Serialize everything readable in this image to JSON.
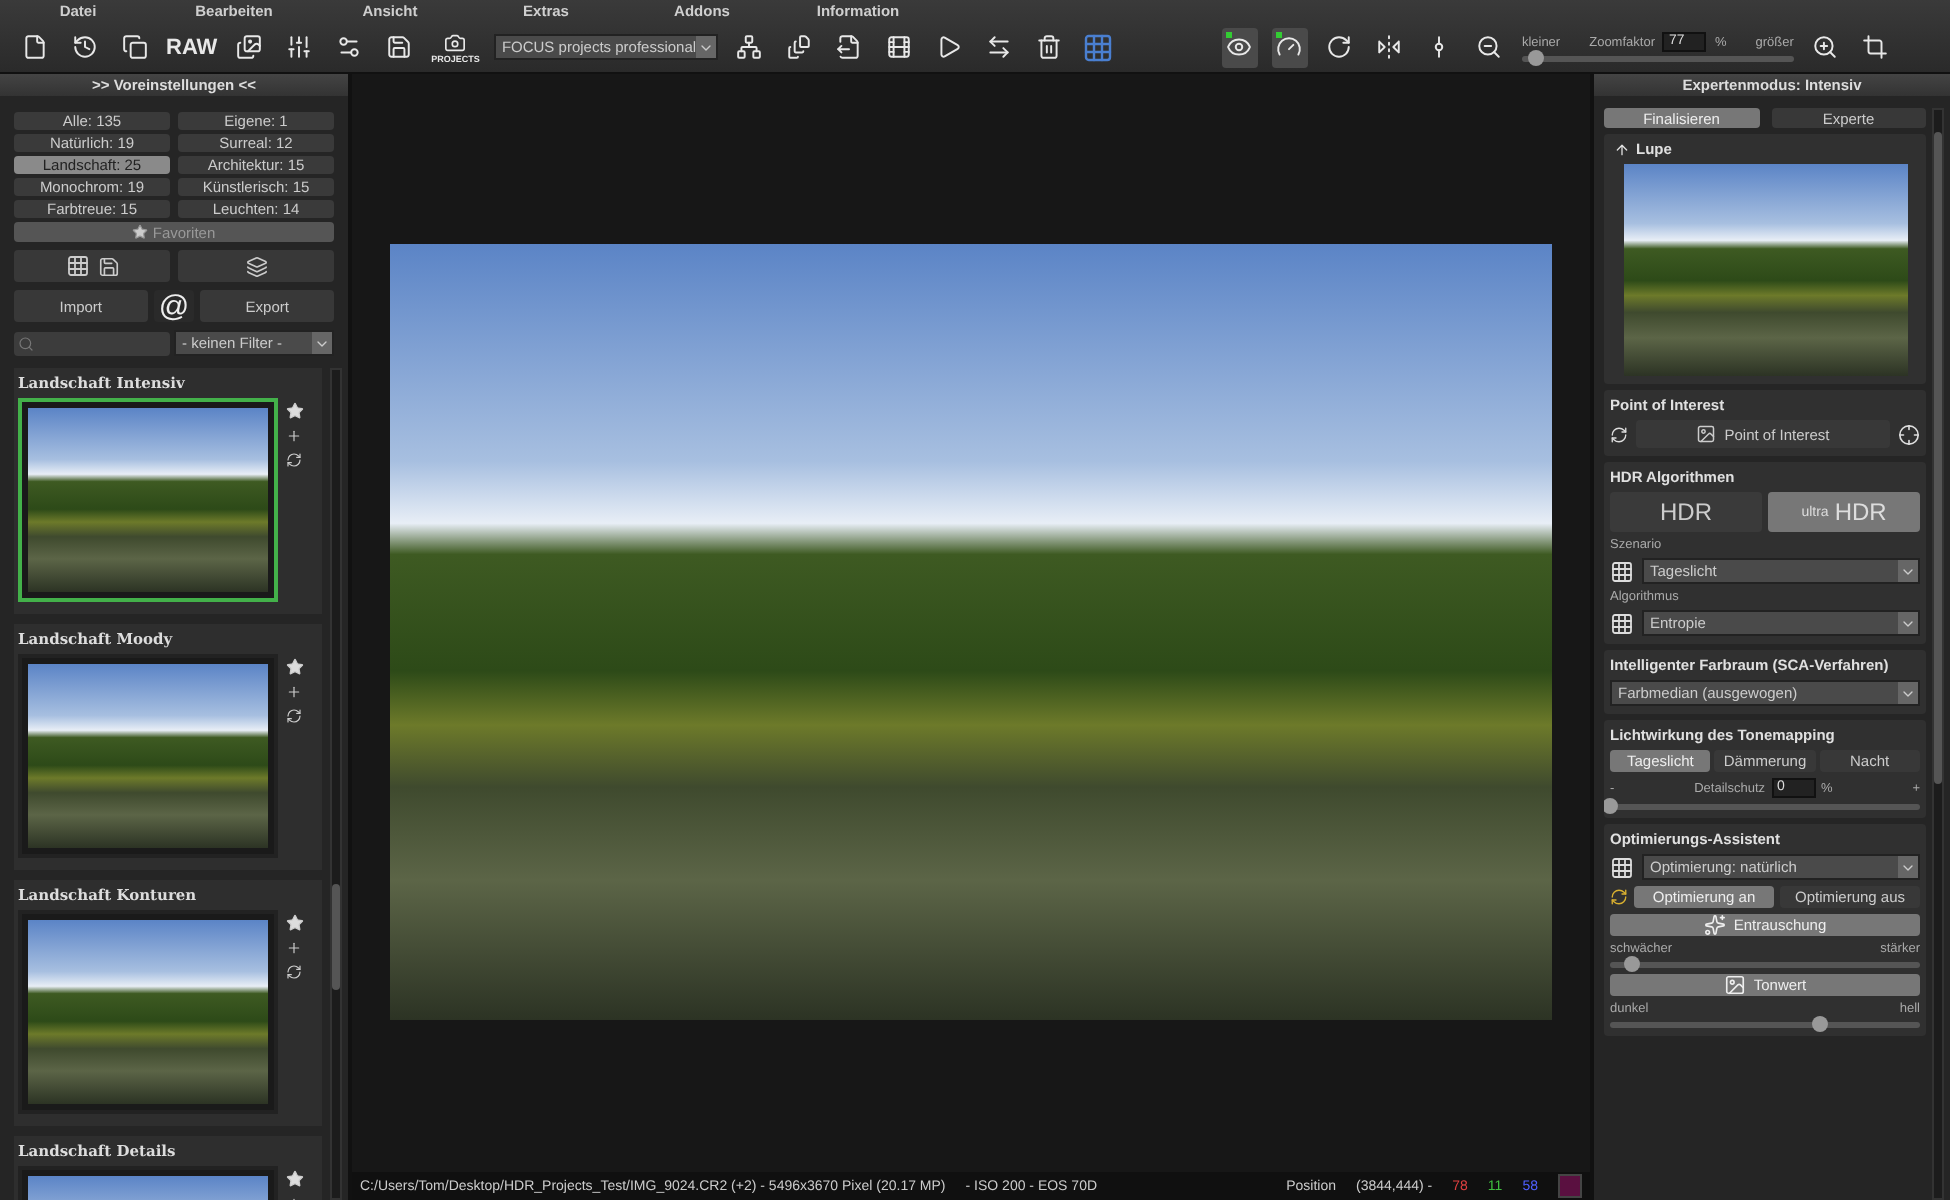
{
  "menu": [
    "Datei",
    "Bearbeiten",
    "Ansicht",
    "Extras",
    "Addons",
    "Information"
  ],
  "toolbar": {
    "raw_label": "RAW",
    "projects_label": "PROJECTS",
    "project_select": "FOCUS projects professional",
    "eye_on": true,
    "gauge_on": true,
    "zoom": {
      "smaller": "kleiner",
      "label": "Zoomfaktor",
      "value": "77",
      "unit": "%",
      "bigger": "größer",
      "level": 0.05
    }
  },
  "presets_panel": {
    "title": ">> Voreinstellungen <<",
    "filters": [
      {
        "label": "Alle: 135",
        "selected": false
      },
      {
        "label": "Eigene: 1",
        "selected": false
      },
      {
        "label": "Natürlich: 19",
        "selected": false
      },
      {
        "label": "Surreal: 12",
        "selected": false
      },
      {
        "label": "Landschaft: 25",
        "selected": true
      },
      {
        "label": "Architektur: 15",
        "selected": false
      },
      {
        "label": "Monochrom: 19",
        "selected": false
      },
      {
        "label": "Künstlerisch: 15",
        "selected": false
      },
      {
        "label": "Farbtreue: 15",
        "selected": false
      },
      {
        "label": "Leuchten: 14",
        "selected": false
      }
    ],
    "favorites": "Favoriten",
    "import": "Import",
    "at": "@",
    "export": "Export",
    "filter_select": "- keinen Filter -",
    "presets": [
      {
        "name": "Landschaft Intensiv",
        "selected": true
      },
      {
        "name": "Landschaft Moody",
        "selected": false
      },
      {
        "name": "Landschaft Konturen",
        "selected": false
      },
      {
        "name": "Landschaft Details",
        "selected": false
      }
    ]
  },
  "expert_panel": {
    "title": "Expertenmodus: Intensiv",
    "tabs": [
      {
        "label": "Finalisieren",
        "selected": true
      },
      {
        "label": "Experte",
        "selected": false
      }
    ],
    "lupe": "Lupe",
    "poi": {
      "title": "Point of Interest",
      "button": "Point of Interest"
    },
    "hdr": {
      "title": "HDR Algorithmen",
      "modes": [
        {
          "label": "HDR",
          "selected": false
        },
        {
          "label": "HDR",
          "prefix": "ultra",
          "selected": true
        }
      ],
      "scenario_label": "Szenario",
      "scenario_value": "Tageslicht",
      "algorithm_label": "Algorithmus",
      "algorithm_value": "Entropie"
    },
    "color_space": {
      "title": "Intelligenter Farbraum (SCA-Verfahren)",
      "value": "Farbmedian (ausgewogen)"
    },
    "tonemapping": {
      "title": "Lichtwirkung des Tonemapping",
      "options": [
        {
          "label": "Tageslicht",
          "selected": true
        },
        {
          "label": "Dämmerung",
          "selected": false
        },
        {
          "label": "Nacht",
          "selected": false
        }
      ],
      "minus": "-",
      "detail_label": "Detailschutz",
      "detail_value": "0",
      "unit": "%",
      "plus": "+",
      "level": 0.0
    },
    "optimization": {
      "title": "Optimierungs-Assistent",
      "select": "Optimierung: natürlich",
      "toggles": [
        {
          "label": "Optimierung an",
          "selected": true
        },
        {
          "label": "Optimierung aus",
          "selected": false
        }
      ],
      "denoise": {
        "label": "Entrauschung",
        "min": "schwächer",
        "max": "stärker",
        "level": 0.07
      },
      "tone": {
        "label": "Tonwert",
        "min": "dunkel",
        "max": "hell",
        "level": 0.68
      }
    }
  },
  "status": {
    "path": "C:/Users/Tom/Desktop/HDR_Projects_Test/IMG_9024.CR2 (+2) - 5496x3670 Pixel (20.17 MP)",
    "info": "- ISO 200 - EOS 70D",
    "position_label": "Position",
    "position": "(3844,444) -",
    "r": "78",
    "g": "11",
    "b": "58",
    "color": "#5a1040"
  }
}
